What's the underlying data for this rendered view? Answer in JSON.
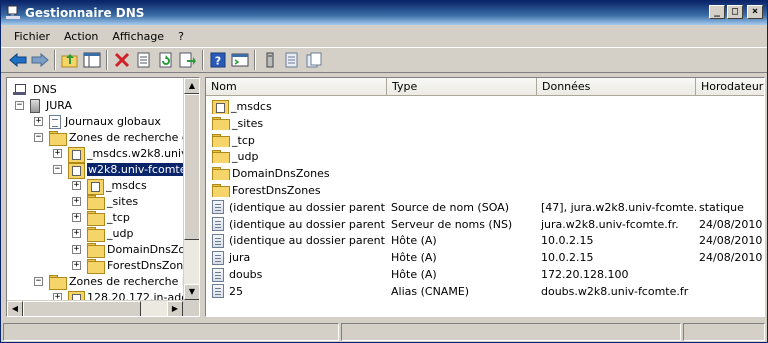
{
  "window": {
    "title": "Gestionnaire DNS",
    "buttons": {
      "minimize": "_",
      "maximize": "□",
      "close": "×"
    }
  },
  "menu": [
    {
      "label": "Fichier"
    },
    {
      "label": "Action"
    },
    {
      "label": "Affichage"
    },
    {
      "label": "?"
    }
  ],
  "toolbar": {
    "icons": [
      "back-arrow-icon",
      "forward-arrow-icon",
      "up-folder-icon",
      "show-hide-tree-icon",
      "delete-icon",
      "properties-icon",
      "refresh-icon",
      "export-list-icon",
      "help-icon",
      "console-icon",
      "server-list-icon",
      "zone-list-icon",
      "record-list-icon"
    ],
    "colors": {
      "arrow": "#1f6fc7",
      "delete": "#d0202a",
      "help": "#2a5ab8",
      "refresh": "#2a9a3a"
    }
  },
  "tree": [
    {
      "label": "DNS",
      "level": 0,
      "expander": "",
      "icon": "dns-icon"
    },
    {
      "label": "JURA",
      "level": 1,
      "expander": "−",
      "icon": "server-icon"
    },
    {
      "label": "Journaux globaux",
      "level": 2,
      "expander": "+",
      "icon": "log-icon"
    },
    {
      "label": "Zones de recherche dire",
      "level": 2,
      "expander": "−",
      "icon": "folder-icon"
    },
    {
      "label": "_msdcs.w2k8.univ-f",
      "level": 3,
      "expander": "+",
      "icon": "zone-icon"
    },
    {
      "label": "w2k8.univ-fcomte.fr",
      "level": 3,
      "expander": "−",
      "icon": "zone-icon",
      "selected": true
    },
    {
      "label": "_msdcs",
      "level": 4,
      "expander": "+",
      "icon": "zone-icon"
    },
    {
      "label": "_sites",
      "level": 4,
      "expander": "+",
      "icon": "folder-icon"
    },
    {
      "label": "_tcp",
      "level": 4,
      "expander": "+",
      "icon": "folder-icon"
    },
    {
      "label": "_udp",
      "level": 4,
      "expander": "+",
      "icon": "folder-icon"
    },
    {
      "label": "DomainDnsZones",
      "level": 4,
      "expander": "+",
      "icon": "folder-icon"
    },
    {
      "label": "ForestDnsZones",
      "level": 4,
      "expander": "+",
      "icon": "folder-icon"
    },
    {
      "label": "Zones de recherche inve",
      "level": 2,
      "expander": "−",
      "icon": "folder-icon"
    },
    {
      "label": "128.20.172.in-addr",
      "level": 3,
      "expander": "+",
      "icon": "zone-icon"
    }
  ],
  "list": {
    "columns": [
      "Nom",
      "Type",
      "Données",
      "Horodateur"
    ],
    "rows": [
      {
        "icon": "zone-icon",
        "name": "_msdcs",
        "type": "",
        "data": "",
        "ts": ""
      },
      {
        "icon": "folder-icon",
        "name": "_sites",
        "type": "",
        "data": "",
        "ts": ""
      },
      {
        "icon": "folder-icon",
        "name": "_tcp",
        "type": "",
        "data": "",
        "ts": ""
      },
      {
        "icon": "folder-icon",
        "name": "_udp",
        "type": "",
        "data": "",
        "ts": ""
      },
      {
        "icon": "folder-icon",
        "name": "DomainDnsZones",
        "type": "",
        "data": "",
        "ts": ""
      },
      {
        "icon": "folder-icon",
        "name": "ForestDnsZones",
        "type": "",
        "data": "",
        "ts": ""
      },
      {
        "icon": "record-icon",
        "name": "(identique au dossier parent)",
        "type": "Source de nom (SOA)",
        "data": "[47], jura.w2k8.univ-fcomte....",
        "ts": "statique"
      },
      {
        "icon": "record-icon",
        "name": "(identique au dossier parent)",
        "type": "Serveur de noms (NS)",
        "data": "jura.w2k8.univ-fcomte.fr.",
        "ts": "24/08/2010"
      },
      {
        "icon": "record-icon",
        "name": "(identique au dossier parent)",
        "type": "Hôte (A)",
        "data": "10.0.2.15",
        "ts": "24/08/2010"
      },
      {
        "icon": "record-icon",
        "name": "jura",
        "type": "Hôte (A)",
        "data": "10.0.2.15",
        "ts": "24/08/2010"
      },
      {
        "icon": "record-icon",
        "name": "doubs",
        "type": "Hôte (A)",
        "data": "172.20.128.100",
        "ts": ""
      },
      {
        "icon": "record-icon",
        "name": "25",
        "type": "Alias (CNAME)",
        "data": "doubs.w2k8.univ-fcomte.fr",
        "ts": ""
      }
    ]
  },
  "statusbar": {
    "sections": [
      "",
      "",
      ""
    ]
  }
}
